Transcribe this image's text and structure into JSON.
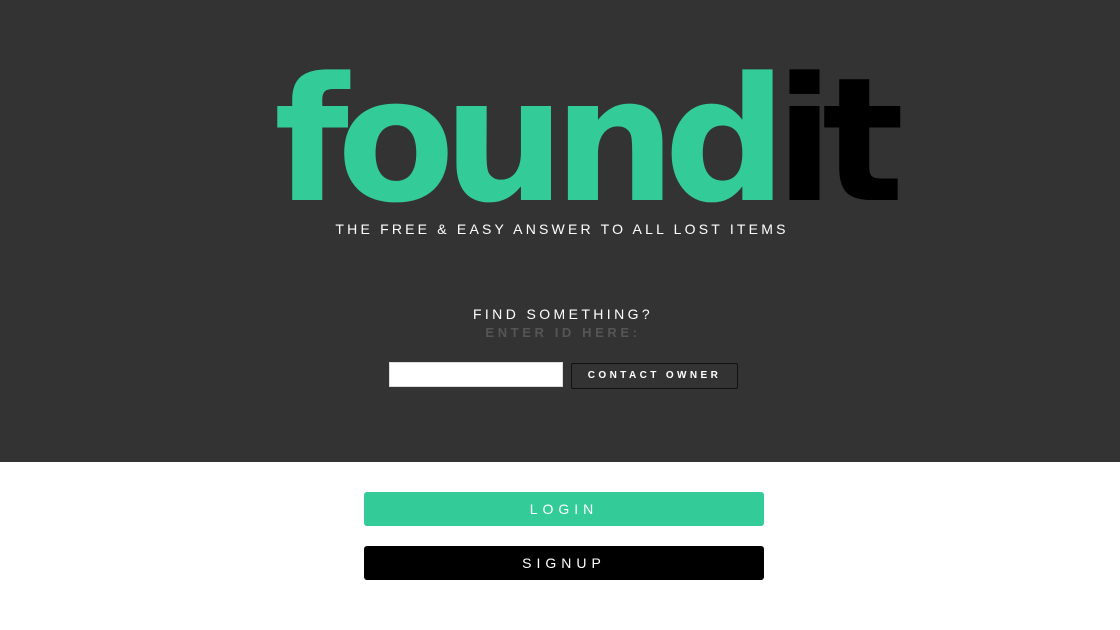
{
  "logo": {
    "part_green": "found",
    "part_dark": "it"
  },
  "tagline": "THE FREE & EASY ANSWER TO ALL LOST ITEMS",
  "find": {
    "heading": "FIND SOMETHING?",
    "subheading": "ENTER ID HERE:",
    "input_value": "",
    "contact_label": "CONTACT OWNER"
  },
  "auth": {
    "login_label": "LOGIN",
    "signup_label": "SIGNUP"
  },
  "colors": {
    "hero_bg": "#333333",
    "brand_green": "#33cc99",
    "dark": "#000000",
    "muted_text": "#555555"
  }
}
